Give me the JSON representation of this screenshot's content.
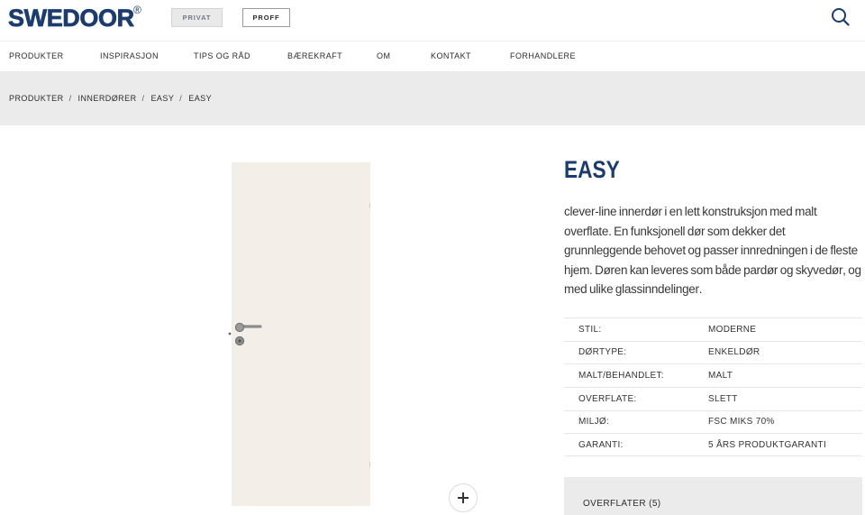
{
  "header": {
    "logo_text": "SWEDOOR",
    "logo_mark": "®",
    "segments": [
      "PRIVAT",
      "PROFF"
    ],
    "search_icon": "search-icon"
  },
  "nav": {
    "items": [
      "PRODUKTER",
      "INSPIRASJON",
      "TIPS OG RÅD",
      "BÆREKRAFT",
      "OM",
      "KONTAKT",
      "FORHANDLERE"
    ]
  },
  "breadcrumb": {
    "items": [
      "PRODUKTER",
      "INNERDØRER",
      "EASY",
      "EASY"
    ],
    "separator": "/"
  },
  "gallery": {
    "zoom_icon": "plus-icon"
  },
  "product": {
    "title": "EASY",
    "description": "clever-line innerdør i en lett konstruksjon med malt overflate. En funksjonell dør som dekker det grunnleggende behovet og passer innredningen i de fleste hjem. Døren kan leveres som både pardør og skyvedør, og med ulike glassinndelinger.",
    "specs": [
      {
        "label": "STIL:",
        "value": "MODERNE"
      },
      {
        "label": "DØRTYPE:",
        "value": "ENKELDØR"
      },
      {
        "label": "MALT/BEHANDLET:",
        "value": "MALT"
      },
      {
        "label": "OVERFLATE:",
        "value": "SLETT"
      },
      {
        "label": "MILJØ:",
        "value": "FSC MIKS 70%"
      },
      {
        "label": "GARANTI:",
        "value": "5 ÅRS PRODUKTGARANTI"
      }
    ],
    "surfaces_section": "OVERFLATER (5)"
  },
  "colors": {
    "brand": "#1c3b6e",
    "text": "#333333",
    "breadcrumb_bg": "#ebebeb",
    "door_panel": "#f3efe8",
    "panel_bg": "#ebebeb",
    "divider": "#e6e6e6"
  }
}
